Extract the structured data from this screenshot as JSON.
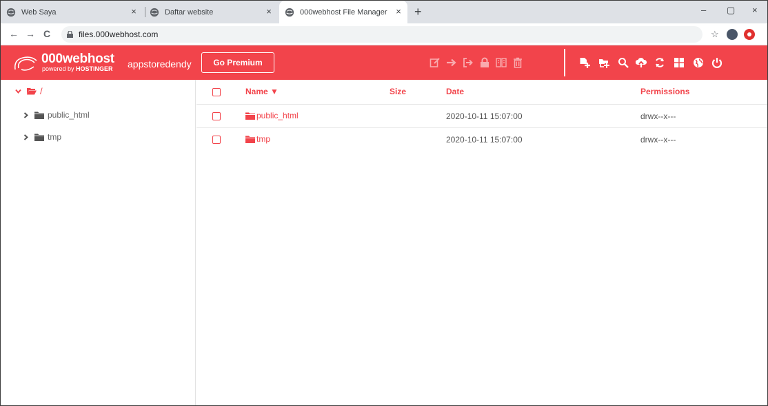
{
  "browser": {
    "tabs": [
      {
        "title": "Web Saya",
        "close": "×",
        "active": false
      },
      {
        "title": "Daftar website",
        "close": "×",
        "active": false
      },
      {
        "title": "000webhost File Manager",
        "close": "×",
        "active": true
      }
    ],
    "new_tab": "+",
    "window_controls": {
      "minimize": "–",
      "maximize": "▢",
      "close": "×"
    },
    "nav": {
      "back": "←",
      "forward": "→",
      "reload": "C"
    },
    "url": "files.000webhost.com",
    "bookmark": "☆"
  },
  "header": {
    "brand": "000webhost",
    "powered_by": "powered by",
    "powered_by_brand": "HOSTINGER",
    "username": "appstoredendy",
    "premium_button": "Go Premium",
    "accent_color": "#f2444b",
    "selection_icons": [
      "edit-icon",
      "move-icon",
      "rename-icon",
      "lock-icon",
      "archive-icon",
      "delete-icon"
    ],
    "action_icons": [
      "new-file-icon",
      "new-folder-icon",
      "search-icon",
      "upload-icon",
      "refresh-icon",
      "grid-view-icon",
      "globe-icon",
      "power-icon"
    ]
  },
  "sidebar": {
    "root": "/",
    "items": [
      {
        "label": "public_html"
      },
      {
        "label": "tmp"
      }
    ]
  },
  "table": {
    "columns": {
      "name": "Name ▼",
      "size": "Size",
      "date": "Date",
      "permissions": "Permissions"
    },
    "rows": [
      {
        "name": "public_html",
        "size": "",
        "date": "2020-10-11 15:07:00",
        "permissions": "drwx--x---"
      },
      {
        "name": "tmp",
        "size": "",
        "date": "2020-10-11 15:07:00",
        "permissions": "drwx--x---"
      }
    ]
  }
}
